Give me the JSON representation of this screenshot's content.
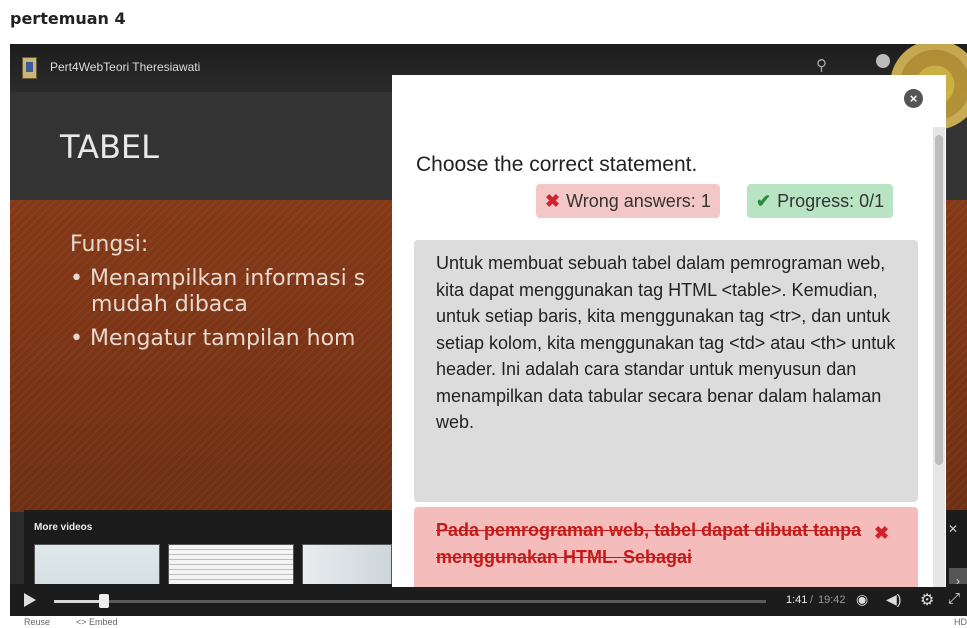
{
  "page": {
    "heading": "pertemuan 4"
  },
  "video": {
    "title": "Pert4WebTeori Theresiawati",
    "slide": {
      "title": "TABEL",
      "label": "Fungsi:",
      "bullet1_line1": "Menampilkan informasi s",
      "bullet1_line2": "mudah dibaca",
      "bullet2": "Mengatur tampilan hom"
    },
    "more_videos_label": "More videos",
    "time_current": "1:41",
    "time_separator": "/",
    "time_total": "19:42",
    "progress_fraction": 0.07,
    "footer": {
      "reuse": "Reuse",
      "embed": "<> Embed",
      "hd": "HD"
    }
  },
  "quiz": {
    "question": "Choose the correct statement.",
    "wrong_answers": "Wrong answers: 1",
    "progress": "Progress: 0/1",
    "answers": [
      {
        "text": "Untuk membuat sebuah tabel dalam pemrograman web, kita dapat menggunakan tag HTML <table>. Kemudian, untuk setiap baris, kita menggunakan tag <tr>, dan untuk setiap kolom, kita menggunakan tag <td> atau <th> untuk header. Ini adalah cara standar untuk menyusun dan menampilkan data tabular secara benar dalam halaman web.",
        "state": "neutral"
      },
      {
        "text": "Pada pemrograman web, tabel dapat dibuat tanpa menggunakan HTML. Sebagai",
        "state": "wrong"
      }
    ]
  },
  "icons": {
    "close": "close-icon",
    "wrong": "x-icon",
    "progress": "check-icon"
  },
  "colors": {
    "wrong_badge_bg": "#f4c7c7",
    "progress_badge_bg": "#b9e4c4",
    "wrong_answer_bg": "#f5bcbc",
    "neutral_answer_bg": "#dcdcdc"
  }
}
